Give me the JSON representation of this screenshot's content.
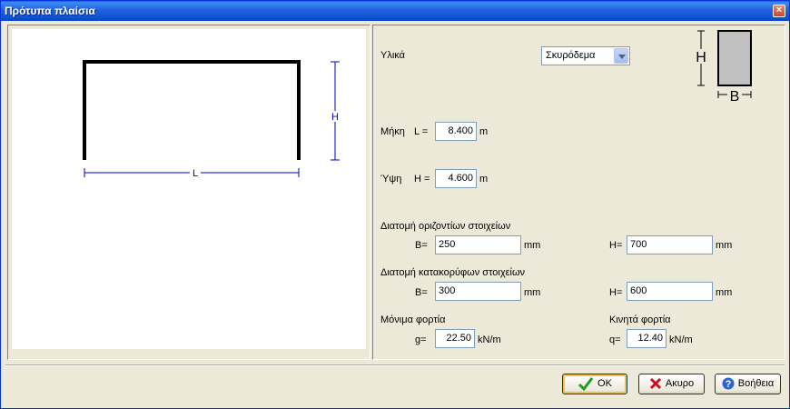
{
  "window": {
    "title": "Πρότυπα πλαίσια",
    "close": "×"
  },
  "preview": {
    "dim_h": "H",
    "dim_l": "L"
  },
  "section_icon": {
    "h": "H",
    "b": "B"
  },
  "form": {
    "material_label": "Υλικά",
    "material_value": "Σκυρόδεμα",
    "length_label": "Μήκη",
    "length_eq": "L =",
    "length_value": "8.400",
    "length_unit": "m",
    "height_label": "Ύψη",
    "height_eq": "H =",
    "height_value": "4.600",
    "height_unit": "m",
    "horiz_label": "Διατομή οριζοντίων στοιχείων",
    "horiz_b_label": "B=",
    "horiz_b_value": "250",
    "horiz_b_unit": "mm",
    "horiz_h_label": "H=",
    "horiz_h_value": "700",
    "horiz_h_unit": "mm",
    "vert_label": "Διατομή κατακορύφων στοιχείων",
    "vert_b_label": "B=",
    "vert_b_value": "300",
    "vert_b_unit": "mm",
    "vert_h_label": "H=",
    "vert_h_value": "600",
    "vert_h_unit": "mm",
    "dead_label": "Μόνιμα φορτία",
    "dead_g_label": "g=",
    "dead_g_value": "22.50",
    "dead_unit": "kN/m",
    "live_label": "Κινητά φορτία",
    "live_q_label": "q=",
    "live_q_value": "12.40",
    "live_unit": "kN/m"
  },
  "buttons": {
    "ok": "OK",
    "cancel": "Ακυρο",
    "help": "Βοήθεια"
  }
}
